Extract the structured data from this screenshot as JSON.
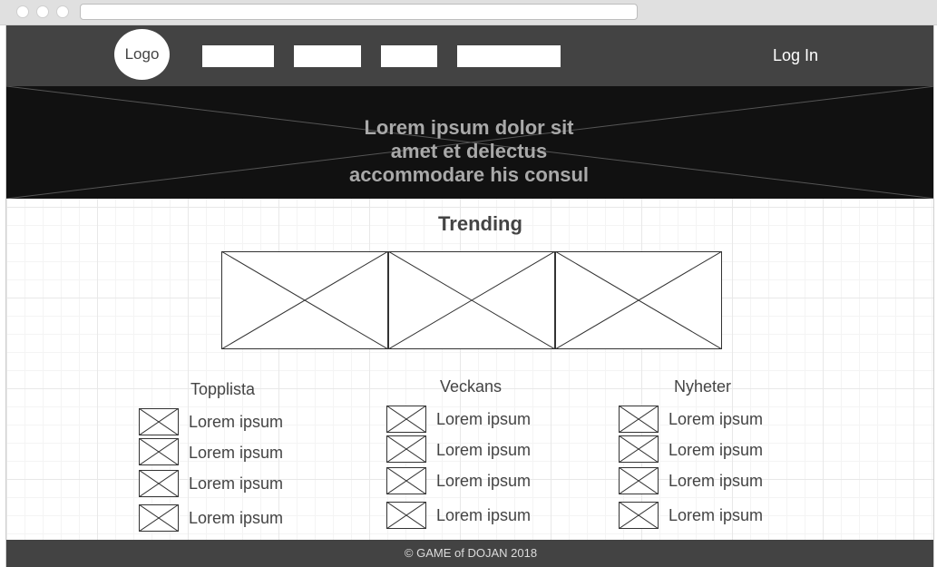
{
  "nav": {
    "logo": "Logo",
    "login": "Log In"
  },
  "hero": {
    "lines": [
      "Lorem ipsum dolor sit",
      "amet et delectus",
      "accommodare his consul"
    ]
  },
  "trending": {
    "title": "Trending"
  },
  "columns": [
    {
      "title": "Topplista",
      "items": [
        "Lorem ipsum",
        "Lorem ipsum",
        "Lorem ipsum",
        "Lorem ipsum"
      ]
    },
    {
      "title": "Veckans",
      "items": [
        "Lorem ipsum",
        "Lorem ipsum",
        "Lorem ipsum",
        "Lorem ipsum"
      ]
    },
    {
      "title": "Nyheter",
      "items": [
        "Lorem ipsum",
        "Lorem ipsum",
        "Lorem ipsum",
        "Lorem ipsum"
      ]
    }
  ],
  "footer": {
    "text": "© GAME of DOJAN 2018"
  }
}
